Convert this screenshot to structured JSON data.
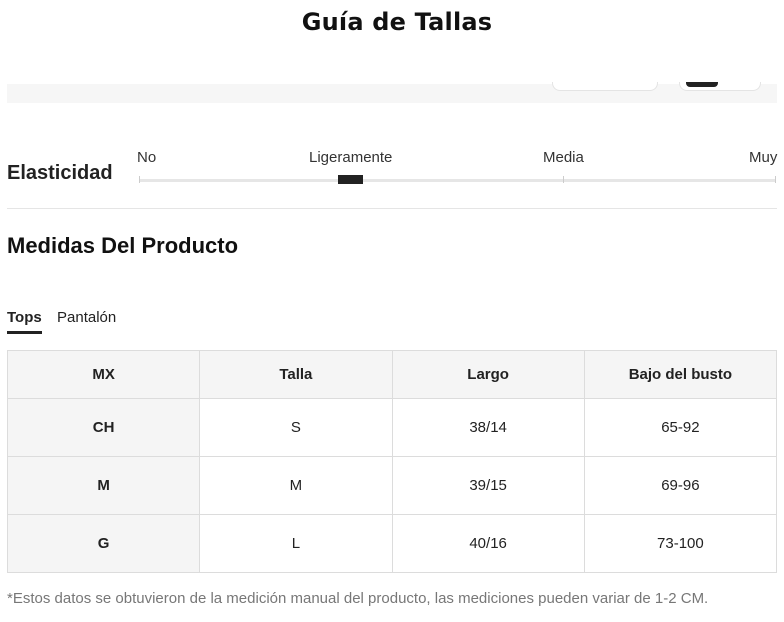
{
  "title": "Guía de Tallas",
  "elasticity": {
    "label": "Elasticidad",
    "levels": [
      "No",
      "Ligeramente",
      "Media",
      "Muy"
    ],
    "selected": "Ligeramente"
  },
  "section_title": "Medidas Del Producto",
  "tabs": [
    {
      "label": "Tops",
      "active": true
    },
    {
      "label": "Pantalón",
      "active": false
    }
  ],
  "table": {
    "headers": [
      "MX",
      "Talla",
      "Largo",
      "Bajo del busto"
    ],
    "rows": [
      [
        "CH",
        "S",
        "38/14",
        "65-92"
      ],
      [
        "M",
        "M",
        "39/15",
        "69-96"
      ],
      [
        "G",
        "L",
        "40/16",
        "73-100"
      ]
    ]
  },
  "footnote": "*Estos datos se obtuvieron de la medición manual del producto, las mediciones pueden variar de 1-2 CM.",
  "colors": {
    "accent": "#222222",
    "header_bg": "#f5f5f5",
    "border": "#dcdcdc"
  }
}
